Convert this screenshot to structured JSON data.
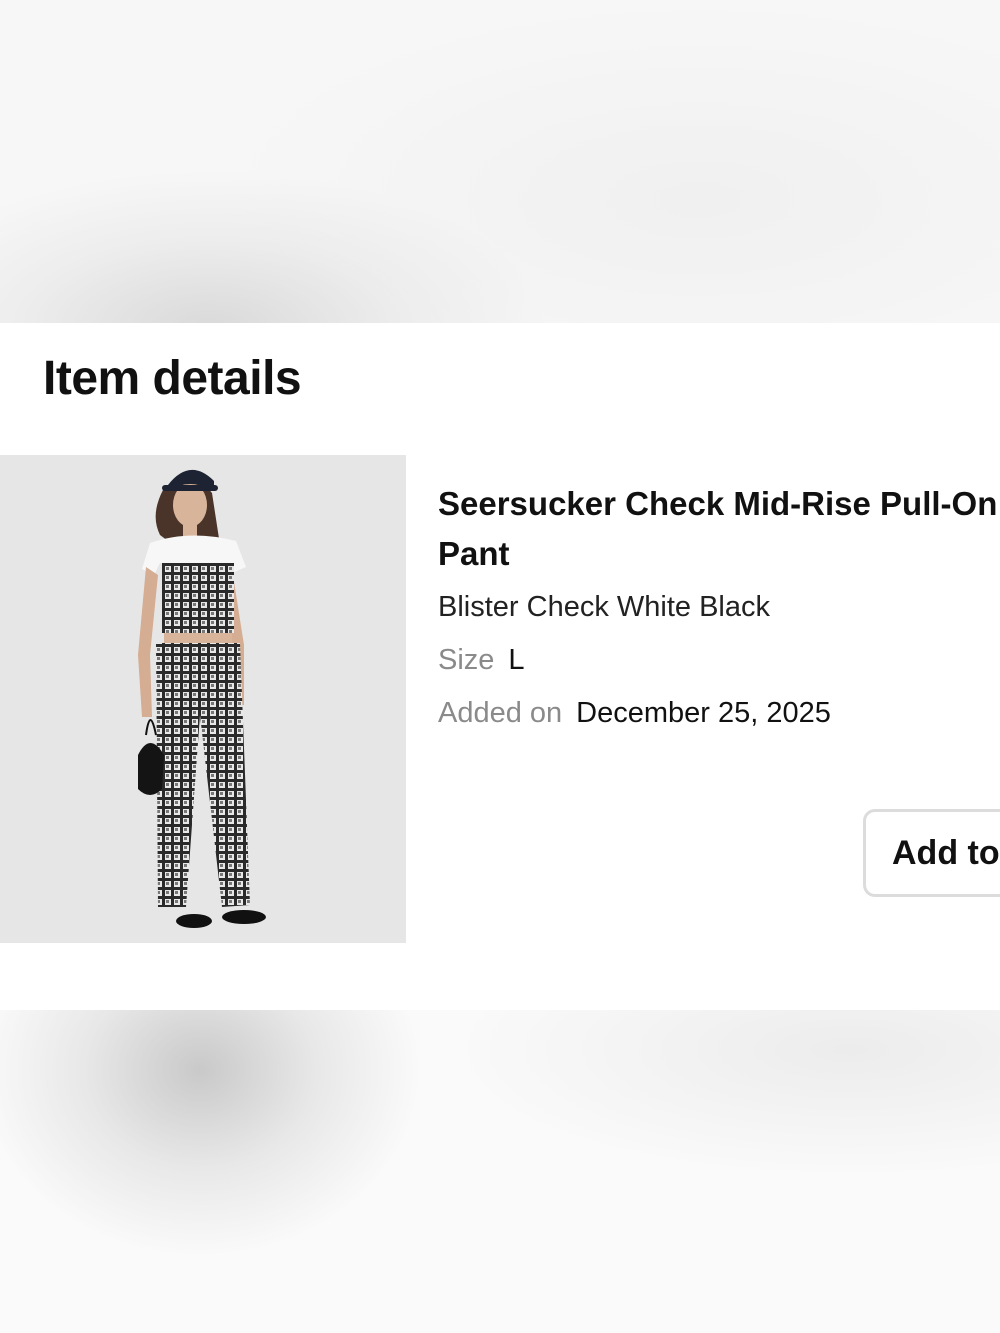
{
  "section": {
    "heading": "Item details"
  },
  "item": {
    "title": "Seersucker Check Mid-Rise Pull-On Pant",
    "color": "Blister Check White Black",
    "size_label": "Size",
    "size_value": "L",
    "added_label": "Added on",
    "added_value": "December 25, 2025",
    "image_icon": "product-photo"
  },
  "actions": {
    "add_button_label": "Add to"
  }
}
